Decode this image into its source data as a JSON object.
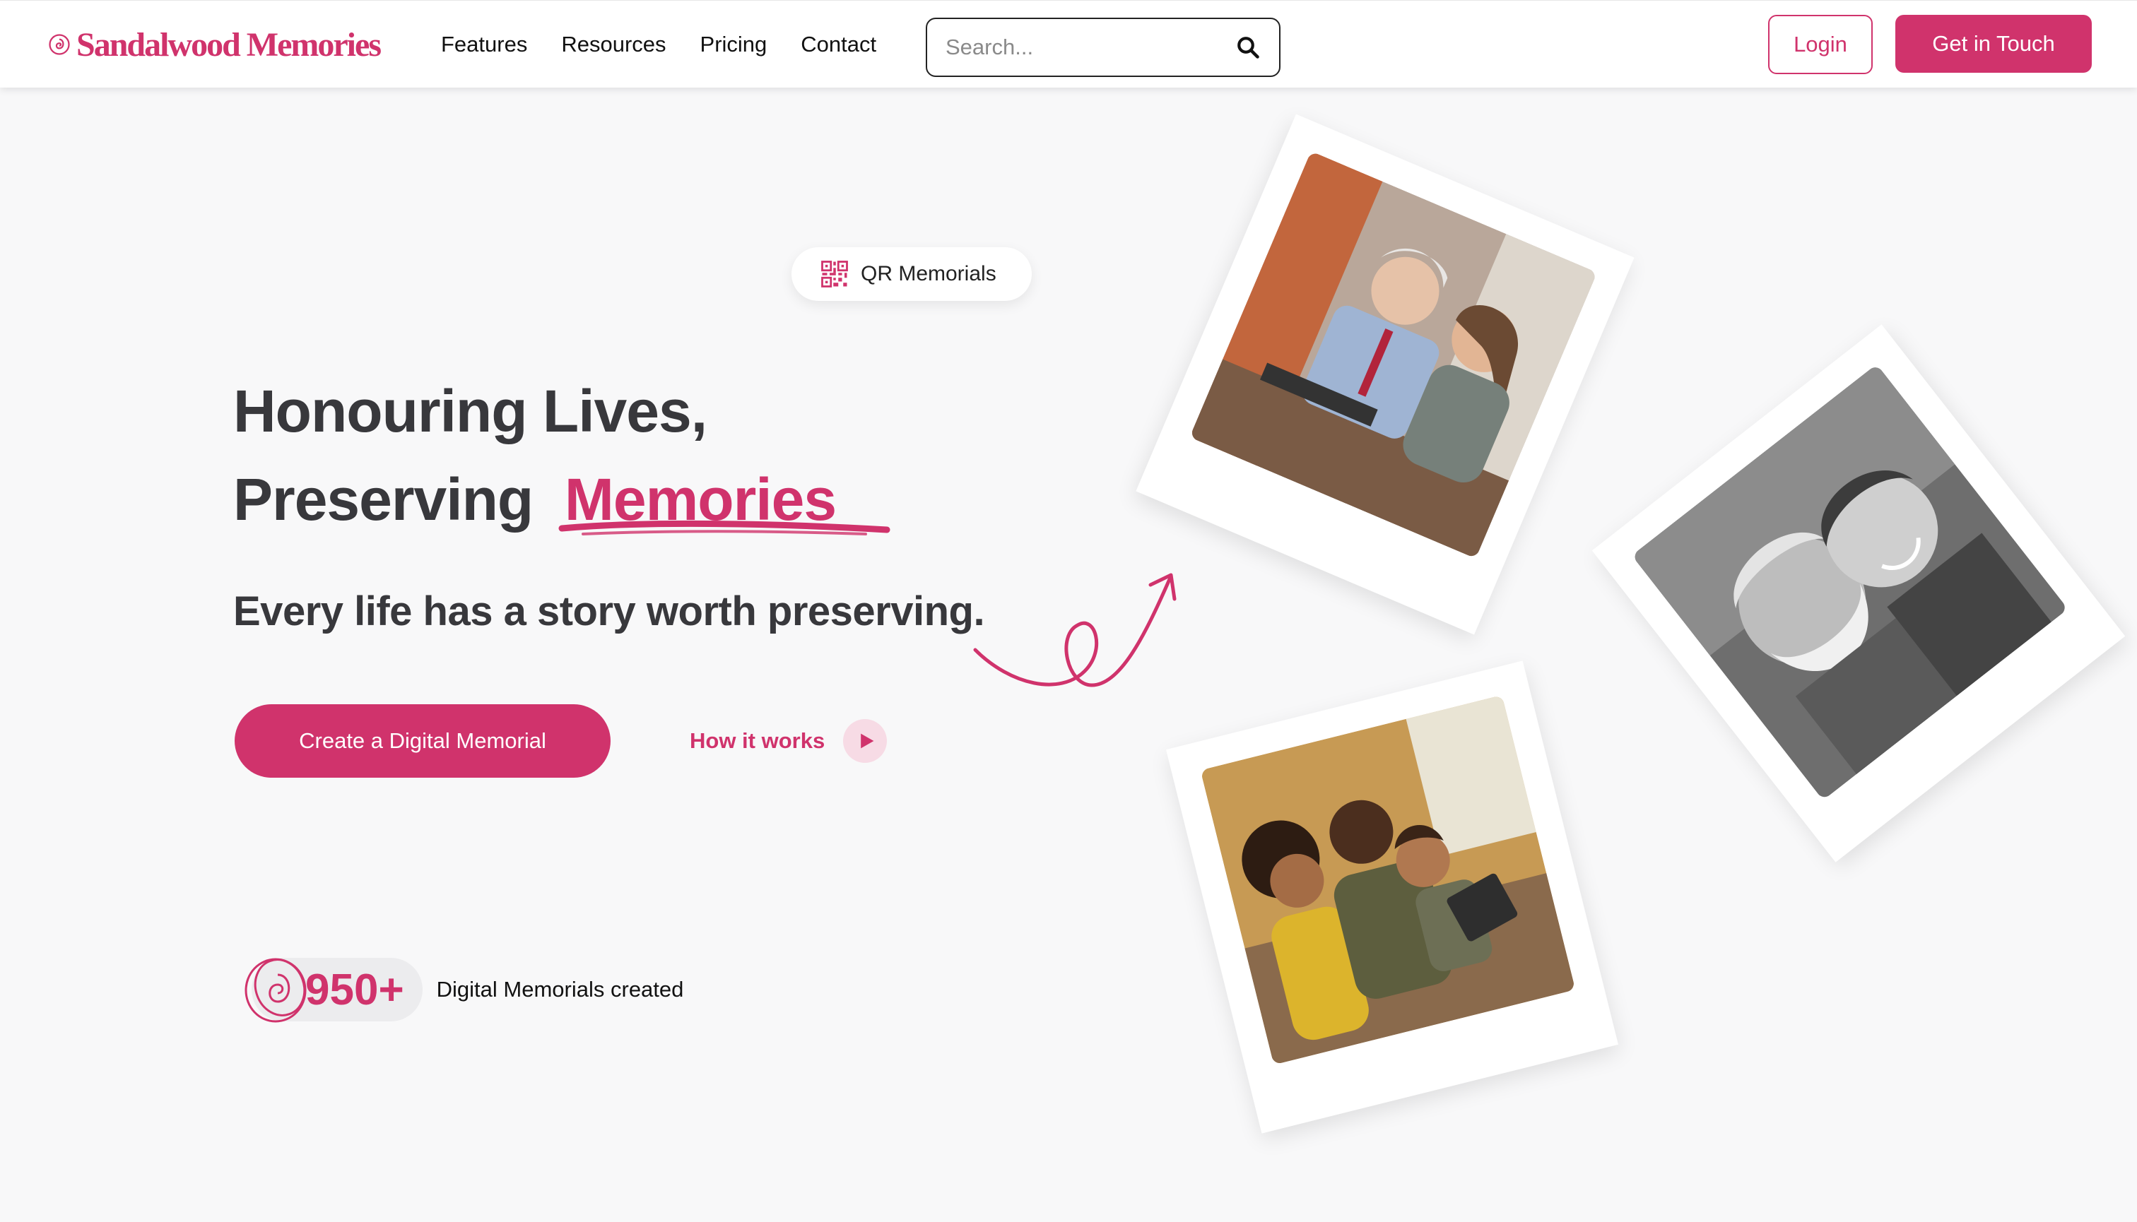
{
  "brand": {
    "name": "Sandalwood Memories",
    "color": "#d0336c"
  },
  "nav": {
    "links": [
      "Features",
      "Resources",
      "Pricing",
      "Contact"
    ],
    "search_placeholder": "Search...",
    "login_label": "Login",
    "cta_label": "Get in Touch"
  },
  "hero": {
    "badge": "QR Memorials",
    "headline_line1": "Honouring Lives,",
    "headline_line2_prefix": "Preserving",
    "headline_line2_accent": "Memories",
    "subheadline": "Every life has a story worth preserving.",
    "primary_cta": "Create a Digital Memorial",
    "secondary_cta": "How it works"
  },
  "stats": {
    "count": "950+",
    "label": "Digital Memorials created"
  },
  "icons": {
    "logo": "rose-swirl-icon",
    "search": "search-icon",
    "qr": "qr-code-icon",
    "play": "play-icon",
    "arrow": "curly-arrow-icon"
  }
}
